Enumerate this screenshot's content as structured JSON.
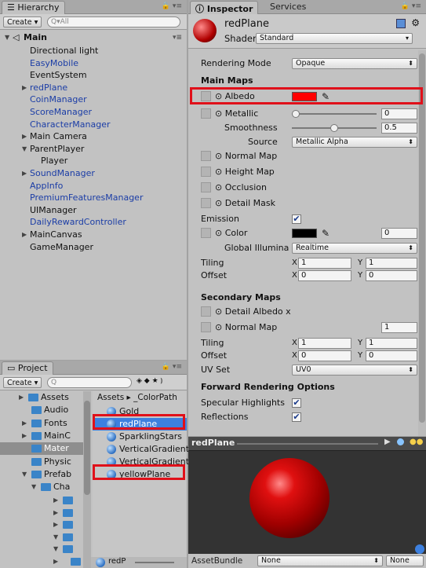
{
  "hierarchy": {
    "tab": "Hierarchy",
    "create_label": "Create ▾",
    "search_placeholder": "Q▾All",
    "scene_name": "Main",
    "items": [
      {
        "label": "Directional light",
        "color": "#111111"
      },
      {
        "label": "EasyMobile",
        "color": "#1b3da6"
      },
      {
        "label": "EventSystem",
        "color": "#111111"
      },
      {
        "label": "redPlane",
        "color": "#1b3da6"
      },
      {
        "label": "CoinManager",
        "color": "#1b3da6"
      },
      {
        "label": "ScoreManager",
        "color": "#1b3da6"
      },
      {
        "label": "CharacterManager",
        "color": "#1b3da6"
      },
      {
        "label": "Main Camera",
        "color": "#111111"
      },
      {
        "label": "ParentPlayer",
        "color": "#111111"
      },
      {
        "label": "Player",
        "color": "#111111"
      },
      {
        "label": "SoundManager",
        "color": "#1b3da6"
      },
      {
        "label": "AppInfo",
        "color": "#1b3da6"
      },
      {
        "label": "PremiumFeaturesManager",
        "color": "#1b3da6"
      },
      {
        "label": "UIManager",
        "color": "#111111"
      },
      {
        "label": "DailyRewardController",
        "color": "#1b3da6"
      },
      {
        "label": "MainCanvas",
        "color": "#111111"
      },
      {
        "label": "GameManager",
        "color": "#111111"
      }
    ]
  },
  "project": {
    "tab": "Project",
    "create_label": "Create ▾",
    "search_placeholder": "Q",
    "breadcrumb": "Assets ▸ _ColorPath",
    "folders": [
      "Assets",
      "Audio",
      "Fonts",
      "MainC",
      "Mater",
      "Physic",
      "Prefab",
      "Cha"
    ],
    "assets": [
      "Gold",
      "redPlane",
      "SparklingStars",
      "VerticalGradient",
      "VerticalGradient",
      "yellowPlane"
    ],
    "selected_asset": "redPlane",
    "footer_label": "redP"
  },
  "inspector": {
    "tab": "Inspector",
    "tab2": "Services",
    "material_name": "redPlane",
    "shader_label": "Shader",
    "shader_value": "Standard",
    "rendering_mode_label": "Rendering Mode",
    "rendering_mode_value": "Opaque",
    "main_maps_label": "Main Maps",
    "albedo_label": "Albedo",
    "albedo_color": "#ff0000",
    "metallic_label": "Metallic",
    "metallic_value": "0",
    "smoothness_label": "Smoothness",
    "smoothness_value": "0.5",
    "source_label": "Source",
    "source_value": "Metallic Alpha",
    "normal_map_label": "Normal Map",
    "height_map_label": "Height Map",
    "occlusion_label": "Occlusion",
    "detail_mask_label": "Detail Mask",
    "emission_label": "Emission",
    "emission_color_label": "Color",
    "emission_color": "#000000",
    "emission_value": "0",
    "gi_label": "Global Illumina",
    "gi_value": "Realtime",
    "tiling_label": "Tiling",
    "offset_label": "Offset",
    "tiling_x": "1",
    "tiling_y": "1",
    "offset_x": "0",
    "offset_y": "0",
    "secondary_maps_label": "Secondary Maps",
    "detail_albedo_label": "Detail Albedo x",
    "sec_normal_map_label": "Normal Map",
    "sec_normal_value": "1",
    "sec_tiling_x": "1",
    "sec_tiling_y": "1",
    "sec_offset_x": "0",
    "sec_offset_y": "0",
    "uv_set_label": "UV Set",
    "uv_set_value": "UV0",
    "forward_label": "Forward Rendering Options",
    "spec_label": "Specular Highlights",
    "refl_label": "Reflections",
    "preview_title": "redPlane",
    "assetbundle_label": "AssetBundle",
    "assetbundle_value": "None",
    "assetbundle_value2": "None",
    "x_label": "X",
    "y_label": "Y"
  },
  "colors": {
    "highlight": "#e0101a",
    "selected": "#3d80df"
  }
}
